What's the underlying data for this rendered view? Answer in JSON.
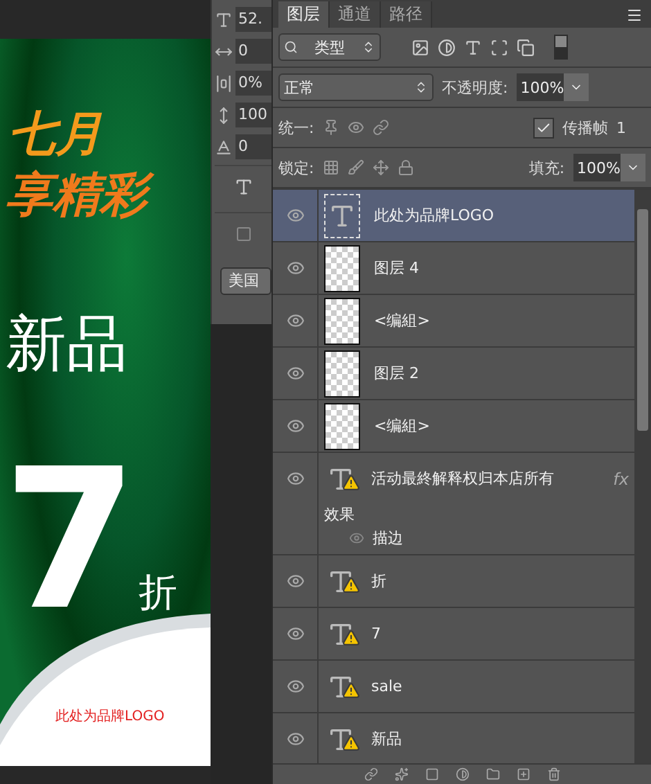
{
  "canvas": {
    "texts": [
      {
        "kind": "headline",
        "text": "七月"
      },
      {
        "kind": "headline2",
        "text": "享精彩"
      },
      {
        "kind": "title",
        "text": "新品"
      },
      {
        "kind": "number",
        "text": "7"
      },
      {
        "kind": "unit",
        "text": "折"
      },
      {
        "kind": "logo",
        "text": "此处为品牌LOGO"
      }
    ]
  },
  "character_panel": {
    "fields": [
      {
        "kind": "size",
        "value": "52."
      },
      {
        "kind": "tracking",
        "value": "0"
      },
      {
        "kind": "spacing",
        "value": "0%"
      },
      {
        "kind": "vscale",
        "value": "100"
      },
      {
        "kind": "baseline",
        "value": "0"
      }
    ],
    "language": "美国"
  },
  "layers_panel": {
    "tabs": [
      {
        "label": "图层",
        "selected": true
      },
      {
        "label": "通道",
        "selected": false
      },
      {
        "label": "路径",
        "selected": false
      }
    ],
    "filter": "类型",
    "blend_mode": "正常",
    "opacity_label": "不透明度:",
    "opacity": "100%",
    "unify_label": "统一:",
    "propagate": {
      "label": "传播帧",
      "checked": true
    },
    "frame": "1",
    "lock_label": "锁定:",
    "fill_label": "填充:",
    "fill": "100%",
    "layers": [
      {
        "name": "此处为品牌LOGO",
        "kind": "text",
        "selected": true,
        "visible": true,
        "warning": false
      },
      {
        "name": "图层 4",
        "kind": "pixel",
        "selected": false,
        "visible": true
      },
      {
        "name": "<编組>",
        "kind": "pixel",
        "selected": false,
        "visible": true
      },
      {
        "name": "图层 2",
        "kind": "pixel",
        "selected": false,
        "visible": true
      },
      {
        "name": "<编組>",
        "kind": "pixel",
        "selected": false,
        "visible": true
      },
      {
        "name": "活动最終解释权归本店所有",
        "kind": "text",
        "selected": false,
        "visible": true,
        "warning": true,
        "fx": "fx",
        "effects": {
          "title": "效果",
          "items": [
            {
              "name": "描边",
              "visible": true
            }
          ]
        }
      },
      {
        "name": "折",
        "kind": "text",
        "selected": false,
        "visible": true,
        "warning": true
      },
      {
        "name": "7",
        "kind": "text",
        "selected": false,
        "visible": true,
        "warning": true
      },
      {
        "name": "sale",
        "kind": "text",
        "selected": false,
        "visible": true,
        "warning": true
      },
      {
        "name": "新品",
        "kind": "text",
        "selected": false,
        "visible": true,
        "warning": true
      }
    ]
  }
}
